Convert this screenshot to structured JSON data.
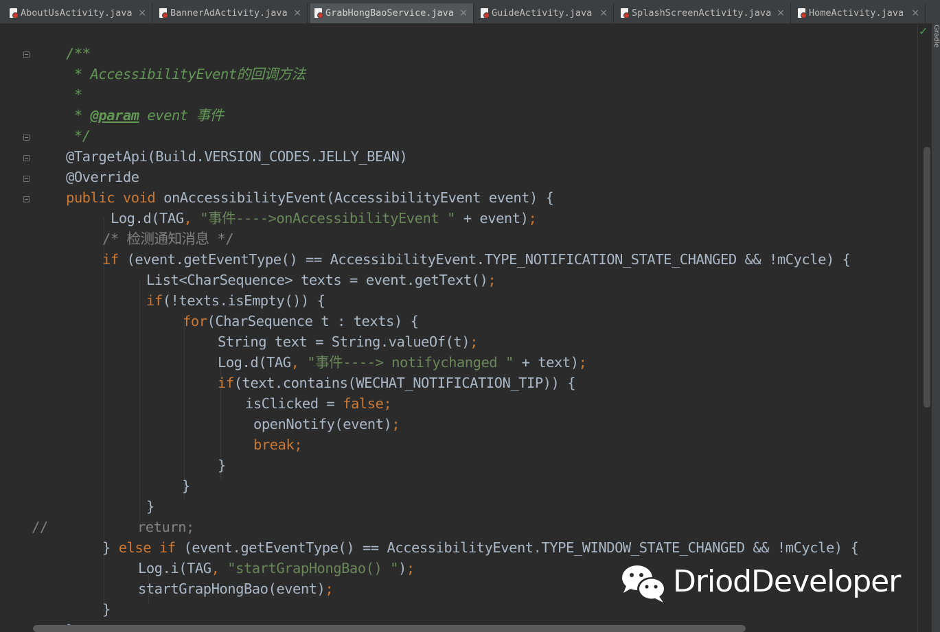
{
  "tabs": [
    {
      "label": "AboutUsActivity.java",
      "close": "×"
    },
    {
      "label": "BannerAdActivity.java",
      "close": "×"
    },
    {
      "label": "GrabHongBaoService.java",
      "close": "×",
      "active": true
    },
    {
      "label": "GuideActivity.java",
      "close": "×"
    },
    {
      "label": "SplashScreenActivity.java",
      "close": "×"
    },
    {
      "label": "HomeActivity.java",
      "close": "×"
    }
  ],
  "right_panel": {
    "gradle_label": "Gradle",
    "status": "✓"
  },
  "code": [
    [
      {
        "t": "/**",
        "c": "c"
      }
    ],
    [
      {
        "t": " * AccessibilityEvent的回调方法",
        "c": "c"
      }
    ],
    [
      {
        "t": " *",
        "c": "c"
      }
    ],
    [
      {
        "t": " * ",
        "c": "c"
      },
      {
        "t": "@param",
        "c": "cb"
      },
      {
        "t": " event 事件",
        "c": "c"
      }
    ],
    [
      {
        "t": " */",
        "c": "c"
      }
    ],
    [
      {
        "t": "@TargetApi(Build.VERSION_CODES.JELLY_BEAN)",
        "c": ""
      }
    ],
    [
      {
        "t": "@Override",
        "c": ""
      }
    ],
    [
      {
        "t": "public void ",
        "c": "k"
      },
      {
        "t": "onAccessibilityEvent(AccessibilityEvent event) {",
        "c": ""
      }
    ],
    [
      {
        "t": "Log.d(TAG",
        "c": ""
      },
      {
        "t": ", ",
        "c": "p"
      },
      {
        "t": "\"事件---->onAccessibilityEvent \"",
        "c": "s"
      },
      {
        "t": " + event)",
        "c": ""
      },
      {
        "t": ";",
        "c": "p"
      }
    ],
    [
      {
        "t": "/* 检测通知消息 */",
        "c": "cm"
      }
    ],
    [
      {
        "t": "if ",
        "c": "k"
      },
      {
        "t": "(event.getEventType() == AccessibilityEvent.TYPE_NOTIFICATION_STATE_CHANGED && !mCycle) {",
        "c": ""
      }
    ],
    [
      {
        "t": "List<CharSequence> texts = event.getText()",
        "c": ""
      },
      {
        "t": ";",
        "c": "p"
      }
    ],
    [
      {
        "t": "if",
        "c": "k"
      },
      {
        "t": "(!texts.isEmpty()) {",
        "c": ""
      }
    ],
    [
      {
        "t": "for",
        "c": "k"
      },
      {
        "t": "(CharSequence t : texts) {",
        "c": ""
      }
    ],
    [
      {
        "t": "String text = String.valueOf(t)",
        "c": ""
      },
      {
        "t": ";",
        "c": "p"
      }
    ],
    [
      {
        "t": "Log.d(TAG",
        "c": ""
      },
      {
        "t": ", ",
        "c": "p"
      },
      {
        "t": "\"事件----> notifychanged \"",
        "c": "s"
      },
      {
        "t": " + text)",
        "c": ""
      },
      {
        "t": ";",
        "c": "p"
      }
    ],
    [
      {
        "t": "if",
        "c": "k"
      },
      {
        "t": "(text.contains(WECHAT_NOTIFICATION_TIP)) {",
        "c": ""
      }
    ],
    [
      {
        "t": "isClicked = ",
        "c": ""
      },
      {
        "t": "false;",
        "c": "k"
      }
    ],
    [
      {
        "t": "openNotify(event)",
        "c": ""
      },
      {
        "t": ";",
        "c": "p"
      }
    ],
    [
      {
        "t": "break;",
        "c": "k"
      }
    ],
    [
      {
        "t": "}",
        "c": ""
      }
    ],
    [
      {
        "t": "}",
        "c": ""
      }
    ],
    [
      {
        "t": "}",
        "c": ""
      }
    ],
    [
      {
        "t": "//           return;",
        "c": "cm"
      }
    ],
    [
      {
        "t": "} ",
        "c": ""
      },
      {
        "t": "else if ",
        "c": "k"
      },
      {
        "t": "(event.getEventType() == AccessibilityEvent.TYPE_WINDOW_STATE_CHANGED && !mCycle) {",
        "c": ""
      }
    ],
    [
      {
        "t": "Log.i(TAG",
        "c": ""
      },
      {
        "t": ", ",
        "c": "p"
      },
      {
        "t": "\"startGrapHongBao() \"",
        "c": "s"
      },
      {
        "t": ")",
        "c": ""
      },
      {
        "t": ";",
        "c": "p"
      }
    ],
    [
      {
        "t": "startGrapHongBao(event)",
        "c": ""
      },
      {
        "t": ";",
        "c": "p"
      }
    ],
    [
      {
        "t": "}",
        "c": ""
      }
    ],
    [
      {
        "t": "}",
        "c": ""
      }
    ]
  ],
  "watermark": {
    "text": "DriodDeveloper",
    "icon": "wechat-icon"
  }
}
